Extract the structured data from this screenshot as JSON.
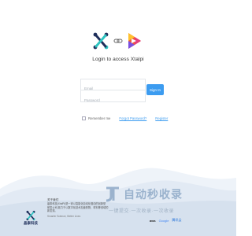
{
  "header": {
    "logo_left_icon": "xtalpi-x-logo",
    "link_icon": "link-chain-icon",
    "logo_right_icon": "colorful-play-logo",
    "title": "Login to access Xtalpi"
  },
  "form": {
    "email_placeholder": "Email",
    "password_placeholder": "Password",
    "signin_label": "Sign In",
    "remember_label": "Remember me",
    "forgot_label": "Forgot Password?",
    "register_label": "Register"
  },
  "footer": {
    "brand_name": "晶泰科技",
    "about_title": "关于我们",
    "about_lines": [
      "晶泰科技(XtalPi)是一家以智能化自动化驱动的创新型",
      "研发公司,致力于以数字化技术加速药物、材料等领域的",
      "新发现。"
    ],
    "slogan": "Smarter Science, Better Lives",
    "partners": [
      "aws",
      "Google",
      "腾讯云"
    ]
  },
  "watermark": {
    "main": "自动秒收录",
    "sub": "一键提交·一次收录·一次收录"
  },
  "colors": {
    "accent": "#3c9cf0",
    "brand_navy": "#1e2e5a",
    "mountain": "#dfe8f3"
  }
}
